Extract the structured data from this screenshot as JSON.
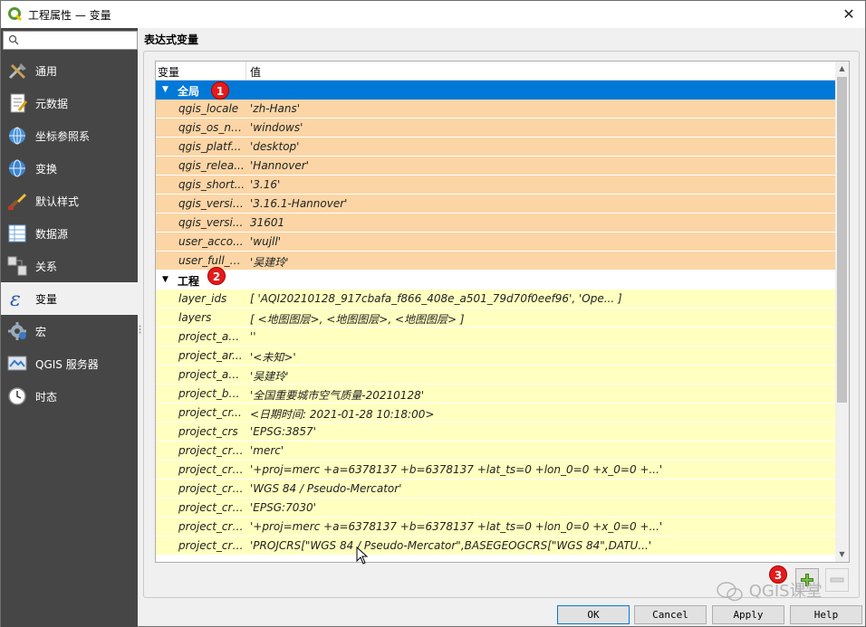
{
  "window": {
    "title": "工程属性 — 变量",
    "close_glyph": "✕"
  },
  "sidebar": {
    "search_placeholder": "",
    "items": [
      {
        "label": "通用",
        "icon": "tools-icon"
      },
      {
        "label": "元数据",
        "icon": "metadata-icon"
      },
      {
        "label": "坐标参照系",
        "icon": "globe-crs-icon"
      },
      {
        "label": "变换",
        "icon": "globe-transform-icon"
      },
      {
        "label": "默认样式",
        "icon": "paintbrush-icon"
      },
      {
        "label": "数据源",
        "icon": "datasource-icon"
      },
      {
        "label": "关系",
        "icon": "relations-icon"
      },
      {
        "label": "变量",
        "icon": "epsilon-icon",
        "active": true
      },
      {
        "label": "宏",
        "icon": "gear-macro-icon"
      },
      {
        "label": "QGIS 服务器",
        "icon": "server-icon"
      },
      {
        "label": "时态",
        "icon": "clock-icon"
      }
    ]
  },
  "main": {
    "section_title": "表达式变量",
    "columns": {
      "variable": "变量",
      "value": "值"
    },
    "global_group": {
      "label": "全局",
      "badge": "1",
      "rows": [
        {
          "key": "qgis_locale",
          "value": "'zh-Hans'"
        },
        {
          "key": "qgis_os_na...",
          "value": "'windows'"
        },
        {
          "key": "qgis_platf...",
          "value": "'desktop'"
        },
        {
          "key": "qgis_relea...",
          "value": "'Hannover'"
        },
        {
          "key": "qgis_short...",
          "value": "'3.16'"
        },
        {
          "key": "qgis_version",
          "value": "'3.16.1-Hannover'"
        },
        {
          "key": "qgis_versi...",
          "value": "31601"
        },
        {
          "key": "user_acco...",
          "value": "'wujll'"
        },
        {
          "key": "user_full_n...",
          "value": "'吴建玲'"
        }
      ]
    },
    "project_group": {
      "label": "工程",
      "badge": "2",
      "rows": [
        {
          "key": "layer_ids",
          "value": "[ 'AQI20210128_917cbafa_f866_408e_a501_79d70f0eef96', 'Ope... ]"
        },
        {
          "key": "layers",
          "value": "[ <地图图层>, <地图图层>, <地图图层> ]"
        },
        {
          "key": "project_ab...",
          "value": "''"
        },
        {
          "key": "project_ar...",
          "value": "'<未知>'"
        },
        {
          "key": "project_au...",
          "value": "'吴建玲'"
        },
        {
          "key": "project_ba...",
          "value": "'全国重要城市空气质量-20210128'"
        },
        {
          "key": "project_cr...",
          "value": "<日期时间: 2021-01-28 10:18:00>"
        },
        {
          "key": "project_crs",
          "value": "'EPSG:3857'"
        },
        {
          "key": "project_crs...",
          "value": "'merc'"
        },
        {
          "key": "project_crs...",
          "value": "'+proj=merc +a=6378137 +b=6378137 +lat_ts=0 +lon_0=0 +x_0=0 +...'"
        },
        {
          "key": "project_crs...",
          "value": "'WGS 84 / Pseudo-Mercator'"
        },
        {
          "key": "project_crs...",
          "value": "'EPSG:7030'"
        },
        {
          "key": "project_crs...",
          "value": "'+proj=merc +a=6378137 +b=6378137 +lat_ts=0 +lon_0=0 +x_0=0 +...'"
        },
        {
          "key": "project_crs...",
          "value": "'PROJCRS[\"WGS 84 / Pseudo-Mercator\",BASEGEOGCRS[\"WGS 84\",DATU...'"
        }
      ]
    },
    "toolbar_badge": "3"
  },
  "buttons": {
    "ok": "OK",
    "cancel": "Cancel",
    "apply": "Apply",
    "help": "Help"
  },
  "watermark": "QGIS课堂",
  "colors": {
    "sidebar": "#464646",
    "selection": "#0078d7",
    "global_row": "#fbd5a5",
    "project_row": "#ffffc0",
    "badge": "#e31b1b"
  }
}
